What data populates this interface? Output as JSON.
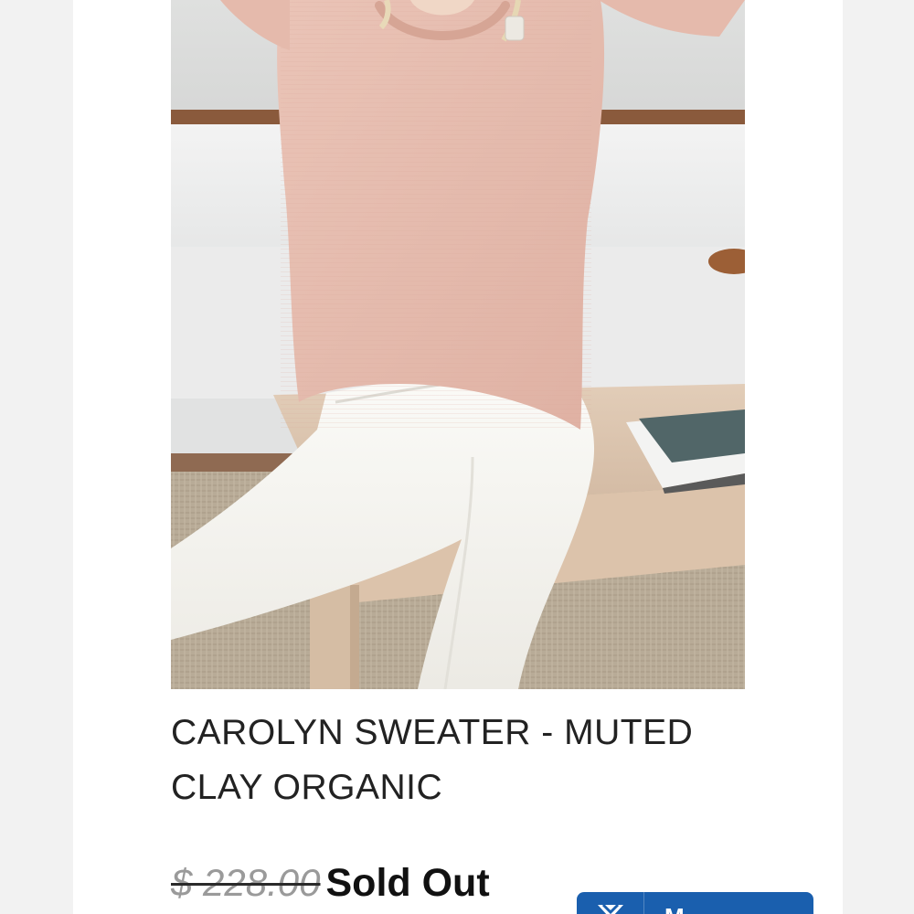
{
  "product": {
    "image_alt": "Model wearing pink knit sweater and white jeans, seated on wooden table",
    "title": "CAROLYN SWEATER - MUTED CLAY ORGANIC",
    "original_price": "$ 228.00",
    "availability": "Sold Out"
  },
  "floating_button": {
    "label": "M",
    "icon": "chat-app-icon",
    "color": "#1a5fae"
  },
  "colors": {
    "sweater": "#e7beb1",
    "jeans": "#f6f5f1",
    "table": "#dcc4ae",
    "background": "#ffffff"
  }
}
